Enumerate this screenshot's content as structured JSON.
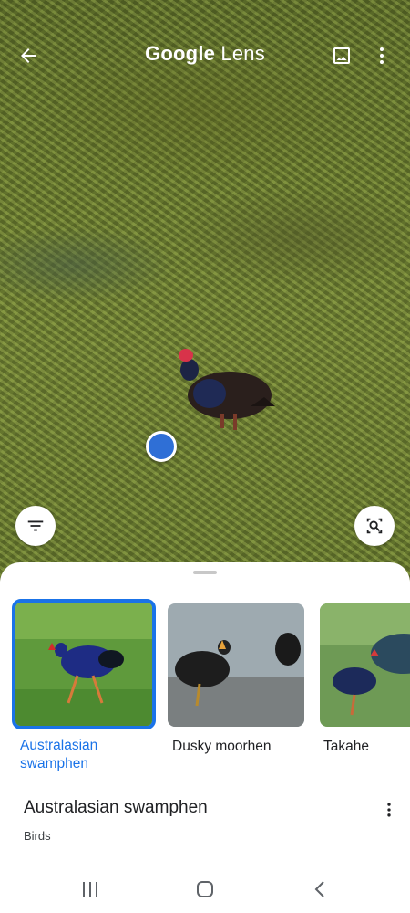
{
  "app": {
    "title_brand": "Google",
    "title_product": "Lens"
  },
  "top_bar": {
    "back_icon": "arrow-left-icon",
    "gallery_icon": "image-icon",
    "more_icon": "more-vert-icon"
  },
  "viewfinder": {
    "filter_icon": "filter-list-icon",
    "search_region_icon": "image-search-icon"
  },
  "results": [
    {
      "label_line1": "Australasian",
      "label_line2": "swamphen",
      "selected": true
    },
    {
      "label_line1": "Dusky moorhen",
      "label_line2": "",
      "selected": false
    },
    {
      "label_line1": "Takahe",
      "label_line2": "",
      "selected": false
    }
  ],
  "detail": {
    "title": "Australasian swamphen",
    "subtitle": "Birds"
  },
  "nav": {
    "recents_icon": "recents-icon",
    "home_icon": "home-icon",
    "back_icon": "chevron-left-icon"
  },
  "colors": {
    "accent": "#1a73e8",
    "focus_dot": "#2f6fd6"
  }
}
